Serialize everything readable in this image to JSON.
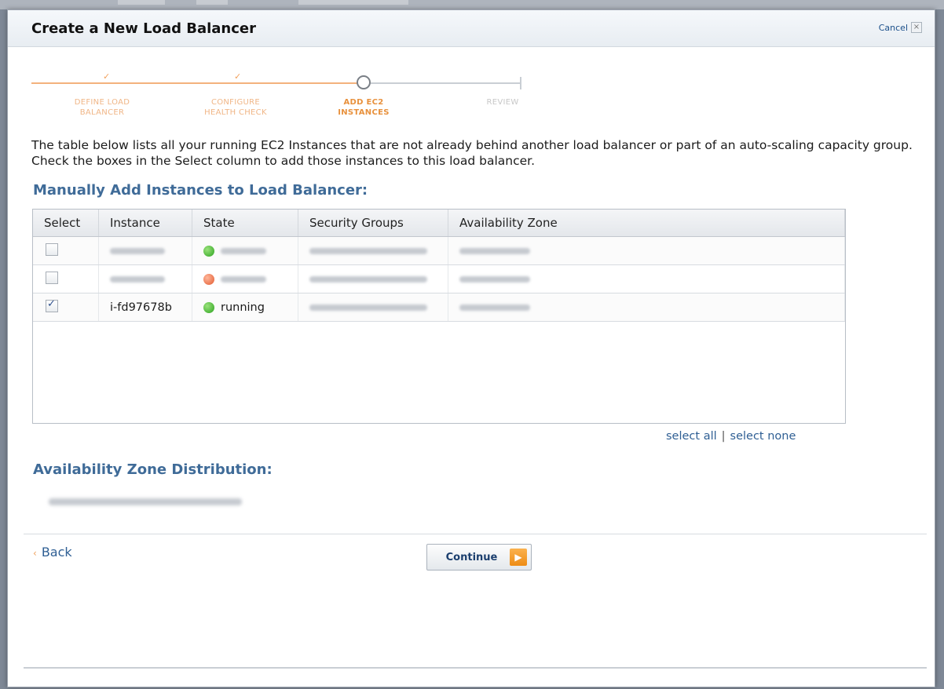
{
  "dialog": {
    "title": "Create a New Load Balancer",
    "cancel_label": "Cancel",
    "close_glyph": "×"
  },
  "steps": [
    {
      "line1": "DEFINE LOAD",
      "line2": "BALANCER",
      "status": "done"
    },
    {
      "line1": "CONFIGURE",
      "line2": "HEALTH CHECK",
      "status": "done"
    },
    {
      "line1": "ADD EC2",
      "line2": "INSTANCES",
      "status": "current"
    },
    {
      "line1": "REVIEW",
      "line2": "",
      "status": "todo"
    }
  ],
  "intro_text": "The table below lists all your running EC2 Instances that are not already behind another load balancer or part of an auto-scaling capacity group. Check the boxes in the Select column to add those instances to this load balancer.",
  "manual_section_title": "Manually Add Instances to Load Balancer:",
  "table": {
    "headers": [
      "Select",
      "Instance",
      "State",
      "Security Groups",
      "Availability Zone"
    ],
    "rows": [
      {
        "checked": false,
        "instance": "",
        "state": "",
        "state_color": "green"
      },
      {
        "checked": false,
        "instance": "",
        "state": "",
        "state_color": "orange"
      },
      {
        "checked": true,
        "instance": "i-fd97678b",
        "state": "running",
        "state_color": "green"
      }
    ]
  },
  "select_links": {
    "all": "select all",
    "separator": "|",
    "none": "select none"
  },
  "az_section_title": "Availability Zone Distribution:",
  "footer": {
    "back_label": "Back",
    "back_glyph": "‹",
    "continue_label": "Continue",
    "continue_glyph": "▶"
  },
  "colors": {
    "accent_blue": "#3f6b98",
    "step_orange": "#e8913d",
    "button_orange": "#ee8c15"
  }
}
